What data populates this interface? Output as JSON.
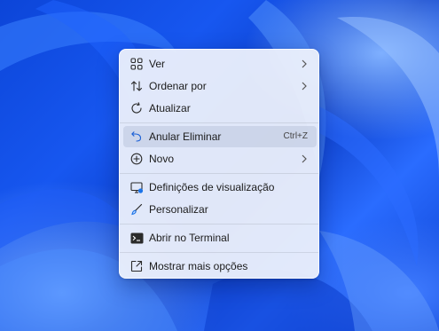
{
  "colors": {
    "menu_background": "#ecf0fb",
    "wallpaper_primary": "#1757f0",
    "icon_stroke": "#2a2a2a",
    "accent": "#1a73e8"
  },
  "context_menu": {
    "items": [
      {
        "label": "Ver",
        "icon": "grid-view-icon",
        "submenu": true
      },
      {
        "label": "Ordenar por",
        "icon": "sort-arrows-icon",
        "submenu": true
      },
      {
        "label": "Atualizar",
        "icon": "refresh-icon",
        "submenu": false
      },
      {
        "label": "Anular Eliminar",
        "icon": "undo-icon",
        "shortcut": "Ctrl+Z",
        "hovered": true
      },
      {
        "label": "Novo",
        "icon": "add-circle-icon",
        "submenu": true
      },
      {
        "label": "Definições de visualização",
        "icon": "display-settings-icon"
      },
      {
        "label": "Personalizar",
        "icon": "brush-icon"
      },
      {
        "label": "Abrir no Terminal",
        "icon": "terminal-icon"
      },
      {
        "label": "Mostrar mais opções",
        "icon": "more-options-icon"
      }
    ]
  }
}
